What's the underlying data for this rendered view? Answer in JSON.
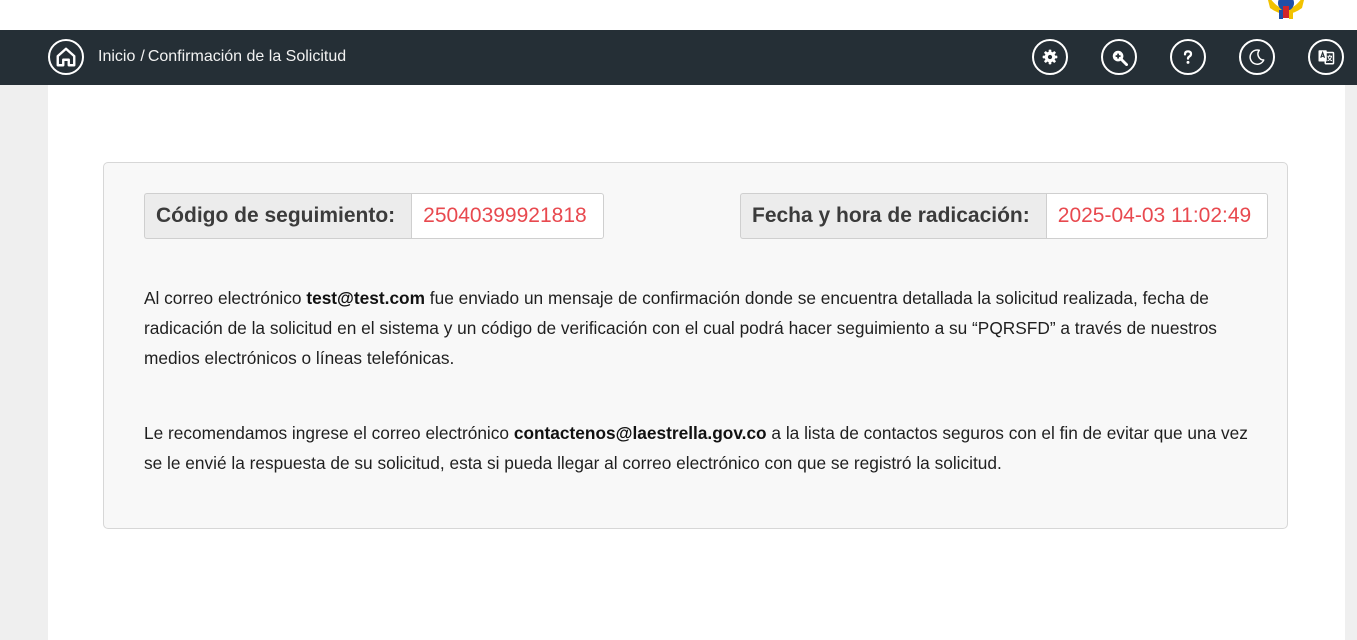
{
  "breadcrumb": {
    "home": "Inicio",
    "separator": "/",
    "current": "Confirmación de la Solicitud"
  },
  "toolbar": {
    "icons": [
      "home-icon",
      "gear-icon",
      "zoom-in-icon",
      "help-icon",
      "moon-icon",
      "translate-icon"
    ]
  },
  "tracking": {
    "code_label": "Código de seguimiento:",
    "code_value": "25040399921818",
    "date_label": "Fecha y hora de radicación:",
    "date_value": "2025-04-03 11:02:49"
  },
  "message1": {
    "pre": "Al correo electrónico ",
    "email": "test@test.com",
    "post": " fue enviado un mensaje de confirmación donde se encuentra detallada la solicitud realizada, fecha de radicación de la solicitud en el sistema y un código de verificación con el cual podrá hacer seguimiento a su “PQRSFD” a través de nuestros medios electrónicos o líneas telefónicas."
  },
  "message2": {
    "pre": "Le recomendamos ingrese el correo electrónico ",
    "email": "contactenos@laestrella.gov.co",
    "post": " a la lista de contactos seguros con el fin de evitar que una vez se le envié la respuesta de su solicitud, esta si pueda llegar al correo electrónico con que se registró la solicitud."
  },
  "colors": {
    "navbar": "#252f36",
    "value_text": "#e8494f",
    "panel_bg": "#f8f8f8"
  }
}
